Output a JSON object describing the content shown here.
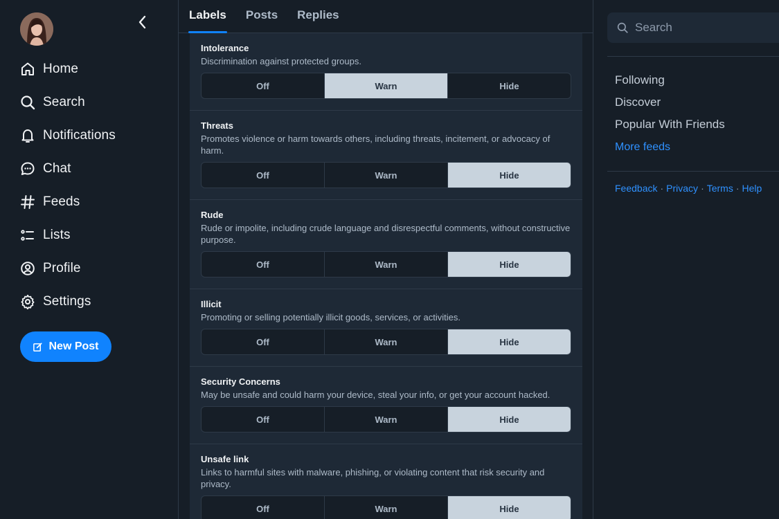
{
  "nav": {
    "items": [
      {
        "label": "Home",
        "icon": "home-icon"
      },
      {
        "label": "Search",
        "icon": "search-icon"
      },
      {
        "label": "Notifications",
        "icon": "bell-icon"
      },
      {
        "label": "Chat",
        "icon": "chat-icon"
      },
      {
        "label": "Feeds",
        "icon": "hash-icon"
      },
      {
        "label": "Lists",
        "icon": "list-icon"
      },
      {
        "label": "Profile",
        "icon": "user-circle-icon"
      },
      {
        "label": "Settings",
        "icon": "gear-icon"
      }
    ],
    "new_post_label": "New Post"
  },
  "tabs": [
    {
      "label": "Labels",
      "active": true
    },
    {
      "label": "Posts",
      "active": false
    },
    {
      "label": "Replies",
      "active": false
    }
  ],
  "labels": [
    {
      "title": "Intolerance",
      "description": "Discrimination against protected groups.",
      "options": [
        "Off",
        "Warn",
        "Hide"
      ],
      "selected": "Warn"
    },
    {
      "title": "Threats",
      "description": "Promotes violence or harm towards others, including threats, incitement, or advocacy of harm.",
      "options": [
        "Off",
        "Warn",
        "Hide"
      ],
      "selected": "Hide"
    },
    {
      "title": "Rude",
      "description": "Rude or impolite, including crude language and disrespectful comments, without constructive purpose.",
      "options": [
        "Off",
        "Warn",
        "Hide"
      ],
      "selected": "Hide"
    },
    {
      "title": "Illicit",
      "description": "Promoting or selling potentially illicit goods, services, or activities.",
      "options": [
        "Off",
        "Warn",
        "Hide"
      ],
      "selected": "Hide"
    },
    {
      "title": "Security Concerns",
      "description": "May be unsafe and could harm your device, steal your info, or get your account hacked.",
      "options": [
        "Off",
        "Warn",
        "Hide"
      ],
      "selected": "Hide"
    },
    {
      "title": "Unsafe link",
      "description": "Links to harmful sites with malware, phishing, or violating content that risk security and privacy.",
      "options": [
        "Off",
        "Warn",
        "Hide"
      ],
      "selected": "Hide"
    }
  ],
  "right": {
    "search_placeholder": "Search",
    "feeds": [
      "Following",
      "Discover",
      "Popular With Friends"
    ],
    "more_feeds": "More feeds",
    "footer": [
      "Feedback",
      "Privacy",
      "Terms",
      "Help"
    ],
    "footer_separator": "·"
  },
  "colors": {
    "background": "#161e27",
    "panel": "#1e2936",
    "accent": "#1083fe",
    "link": "#2f91ff",
    "selected_segment": "#c8d3dd"
  }
}
